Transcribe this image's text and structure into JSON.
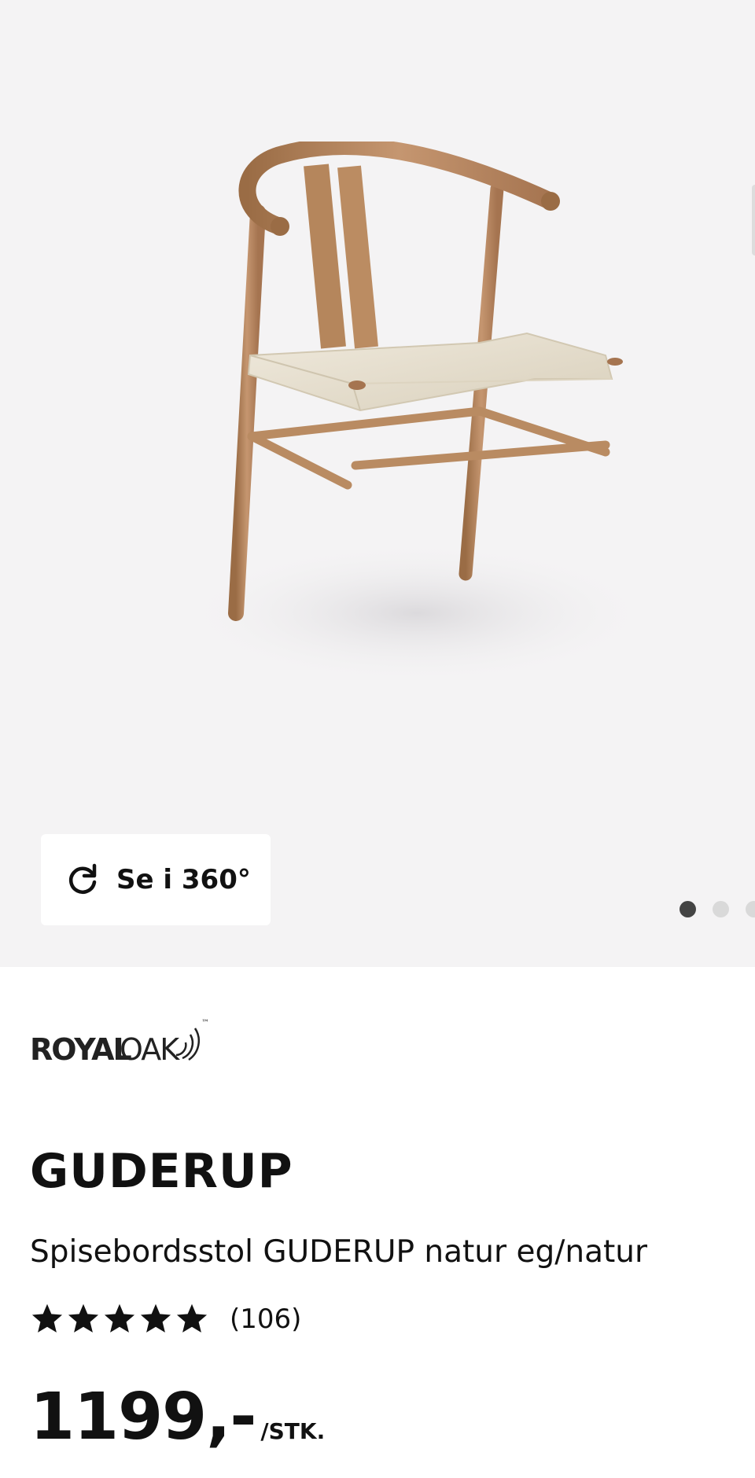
{
  "gallery": {
    "view_360_label": "Se i 360°",
    "image_count": 3,
    "active_image_index": 0
  },
  "brand": {
    "logo_text_bold": "ROYAL",
    "logo_text_light": "OAK",
    "trademark": "™"
  },
  "product": {
    "title": "GUDERUP",
    "subtitle": "Spisebordsstol GUDERUP natur eg/natur",
    "rating_stars": 5,
    "review_count": "(106)",
    "price": "1199,-",
    "price_unit": "/STK."
  },
  "colors": {
    "gallery_bg": "#f4f3f4",
    "text": "#111111",
    "wood": "#b98b62",
    "seat_cord": "#e6dfcf"
  }
}
